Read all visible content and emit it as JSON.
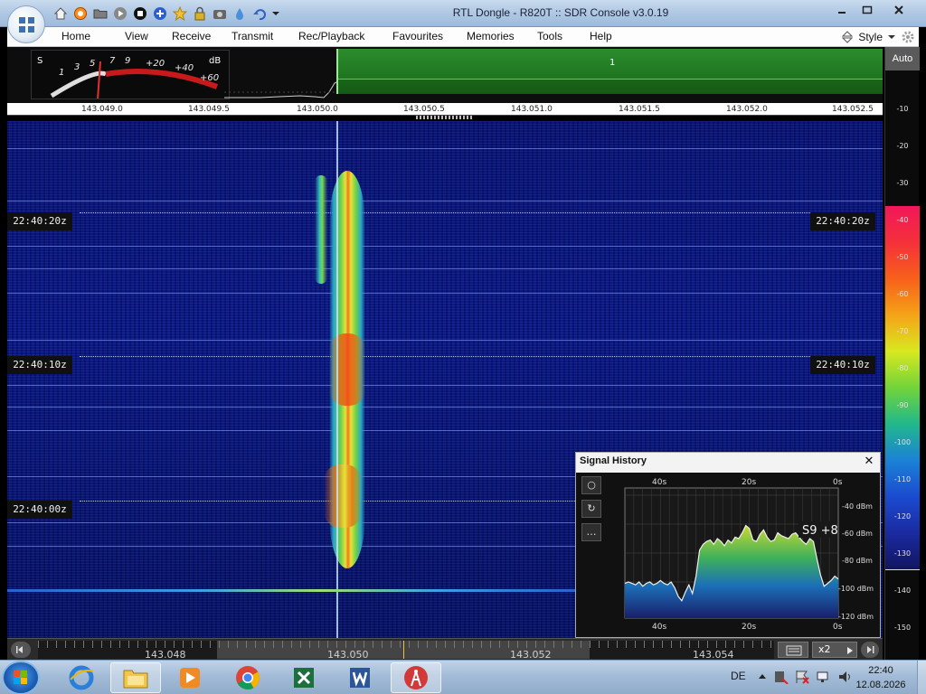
{
  "window": {
    "title": "RTL Dongle - R820T :: SDR Console v3.0.19"
  },
  "quick_access": [
    "home-icon",
    "lifebuoy-icon",
    "folder-icon",
    "play-icon",
    "stop-icon",
    "plus-icon",
    "star-icon",
    "lock-icon",
    "camera-icon",
    "drop-icon",
    "undo-icon",
    "dropdown-icon"
  ],
  "menu": {
    "items": [
      "Home",
      "View",
      "Receive",
      "Transmit",
      "Rec/Playback",
      "Favourites",
      "Memories",
      "Tools",
      "Help"
    ],
    "style_label": "Style"
  },
  "smeter": {
    "s_label": "S",
    "db_label": "dB",
    "scale": [
      "1",
      "3",
      "5",
      "7",
      "9",
      "+20",
      "+40",
      "+60"
    ]
  },
  "spectrum": {
    "vfo_marker": "1"
  },
  "frequency_ruler": [
    "143.049.0",
    "143.049.5",
    "143.050.0",
    "143.050.5",
    "143.051.0",
    "143.051.5",
    "143.052.0",
    "143.052.5"
  ],
  "waterfall": {
    "timestamps_left": [
      "22:40:20z",
      "22:40:10z",
      "22:40:00z"
    ],
    "timestamps_right": [
      "22:40:20z",
      "22:40:10z"
    ]
  },
  "db_scale": {
    "auto_label": "Auto",
    "labels": [
      "-10",
      "-20",
      "-30",
      "-40",
      "-50",
      "-60",
      "-70",
      "-80",
      "-90",
      "-100",
      "-110",
      "-120",
      "-130",
      "-140",
      "-150"
    ]
  },
  "bottom_bar": {
    "freqs": [
      "143.048",
      "143.050",
      "143.052",
      "143.054"
    ],
    "zoom_label": "x2"
  },
  "signal_history": {
    "title": "Signal History",
    "buttons": [
      "○",
      "↻",
      "…"
    ],
    "readout": "S9 +8",
    "time_top": [
      "40s",
      "20s",
      "0s"
    ],
    "time_bottom": [
      "40s",
      "20s",
      "0s"
    ],
    "dbm_labels": [
      "-40 dBm",
      "-60 dBm",
      "-80 dBm",
      "-100 dBm",
      "-120 dBm"
    ],
    "trace_dbm": [
      -101,
      -100,
      -101,
      -102,
      -100,
      -103,
      -101,
      -100,
      -102,
      -101,
      -99,
      -101,
      -102,
      -100,
      -104,
      -110,
      -113,
      -107,
      -102,
      -108,
      -96,
      -78,
      -74,
      -72,
      -71,
      -74,
      -70,
      -72,
      -75,
      -71,
      -73,
      -69,
      -70,
      -66,
      -61,
      -63,
      -71,
      -72,
      -67,
      -64,
      -69,
      -72,
      -71,
      -66,
      -68,
      -69,
      -70,
      -67,
      -66,
      -69,
      -72,
      -74,
      -70,
      -72,
      -84,
      -95,
      -103,
      -101,
      -99,
      -96,
      -98
    ]
  },
  "taskbar": {
    "apps": [
      "ie-icon",
      "explorer-icon",
      "media-player-icon",
      "chrome-icon",
      "excel-icon",
      "word-icon",
      "sdr-console-icon"
    ],
    "language": "DE",
    "time": "22:40",
    "date": "12.08.2026"
  }
}
